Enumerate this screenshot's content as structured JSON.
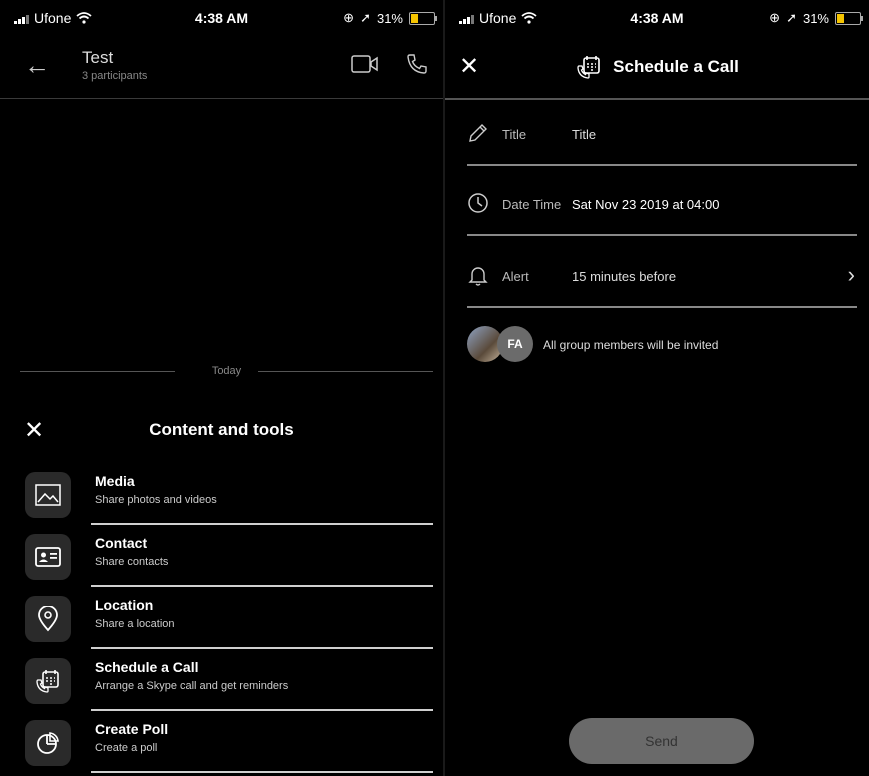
{
  "status_left": {
    "carrier": "Ufone",
    "time": "4:38 AM",
    "battery": "31%"
  },
  "status_right": {
    "carrier": "Ufone",
    "time": "4:38 AM",
    "battery": "31%"
  },
  "chat": {
    "title": "Test",
    "subtitle": "3 participants",
    "divider_label": "Today"
  },
  "content_tools": {
    "title": "Content and tools",
    "items": [
      {
        "title": "Media",
        "desc": "Share photos and videos",
        "icon": "image-icon"
      },
      {
        "title": "Contact",
        "desc": "Share contacts",
        "icon": "contact-card-icon"
      },
      {
        "title": "Location",
        "desc": "Share a location",
        "icon": "location-pin-icon"
      },
      {
        "title": "Schedule a Call",
        "desc": "Arrange a Skype call and get reminders",
        "icon": "schedule-call-icon"
      },
      {
        "title": "Create Poll",
        "desc": "Create a poll",
        "icon": "poll-icon"
      }
    ]
  },
  "schedule": {
    "title": "Schedule a Call",
    "fields": {
      "title_label": "Title",
      "title_value": "Title",
      "datetime_label": "Date Time",
      "datetime_value": "Sat Nov 23 2019 at 04:00",
      "alert_label": "Alert",
      "alert_value": "15 minutes before"
    },
    "invite_avatar_initials": "FA",
    "invite_text": "All group members will be invited",
    "send_label": "Send"
  },
  "colors": {
    "battery": "#f5c400",
    "send_button": "#6a6a6a",
    "icon_box": "#2a2a2a"
  }
}
